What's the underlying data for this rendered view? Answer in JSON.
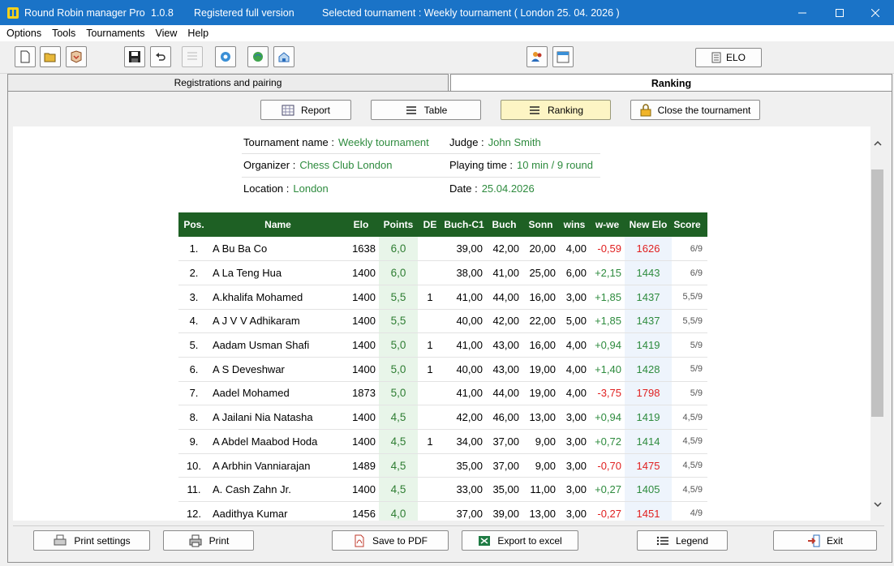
{
  "titlebar": {
    "app_name": "Round Robin manager Pro",
    "version": "1.0.8",
    "license": "Registered full version",
    "selected": "Selected tournament : Weekly tournament  ( London 25. 04. 2026 )"
  },
  "menu": [
    "Options",
    "Tools",
    "Tournaments",
    "View",
    "Help"
  ],
  "toolbar": {
    "elo_label": "ELO"
  },
  "tabs": {
    "registrations": "Registrations and pairing",
    "ranking": "Ranking"
  },
  "subbuttons": {
    "report": "Report",
    "table": "Table",
    "ranking": "Ranking",
    "close": "Close the tournament"
  },
  "info": {
    "name_label": "Tournament name :",
    "name_value": "Weekly tournament",
    "organizer_label": "Organizer :",
    "organizer_value": "Chess Club London",
    "location_label": "Location :",
    "location_value": "London",
    "judge_label": "Judge :",
    "judge_value": "John Smith",
    "playing_label": "Playing time :",
    "playing_value": "10 min / 9 round",
    "date_label": "Date :",
    "date_value": "25.04.2026"
  },
  "table": {
    "headers": [
      "Pos.",
      "Name",
      "Elo",
      "Points",
      "DE",
      "Buch-C1",
      "Buch",
      "Sonn",
      "wins",
      "w-we",
      "New Elo",
      "Score"
    ],
    "rows": [
      {
        "pos": "1.",
        "name": "A Bu Ba Co",
        "elo": "1638",
        "points": "6,0",
        "de": "",
        "buch1": "39,00",
        "buch": "42,00",
        "sonn": "20,00",
        "wins": "4,00",
        "wwe": "-0,59",
        "newelo": "1626",
        "score": "6/9"
      },
      {
        "pos": "2.",
        "name": "A La Teng Hua",
        "elo": "1400",
        "points": "6,0",
        "de": "",
        "buch1": "38,00",
        "buch": "41,00",
        "sonn": "25,00",
        "wins": "6,00",
        "wwe": "+2,15",
        "newelo": "1443",
        "score": "6/9"
      },
      {
        "pos": "3.",
        "name": "A.khalifa Mohamed",
        "elo": "1400",
        "points": "5,5",
        "de": "1",
        "buch1": "41,00",
        "buch": "44,00",
        "sonn": "16,00",
        "wins": "3,00",
        "wwe": "+1,85",
        "newelo": "1437",
        "score": "5,5/9"
      },
      {
        "pos": "4.",
        "name": "A J V V Adhikaram",
        "elo": "1400",
        "points": "5,5",
        "de": "",
        "buch1": "40,00",
        "buch": "42,00",
        "sonn": "22,00",
        "wins": "5,00",
        "wwe": "+1,85",
        "newelo": "1437",
        "score": "5,5/9"
      },
      {
        "pos": "5.",
        "name": "Aadam Usman Shafi",
        "elo": "1400",
        "points": "5,0",
        "de": "1",
        "buch1": "41,00",
        "buch": "43,00",
        "sonn": "16,00",
        "wins": "4,00",
        "wwe": "+0,94",
        "newelo": "1419",
        "score": "5/9"
      },
      {
        "pos": "6.",
        "name": "A S Deveshwar",
        "elo": "1400",
        "points": "5,0",
        "de": "1",
        "buch1": "40,00",
        "buch": "43,00",
        "sonn": "19,00",
        "wins": "4,00",
        "wwe": "+1,40",
        "newelo": "1428",
        "score": "5/9"
      },
      {
        "pos": "7.",
        "name": "Aadel Mohamed",
        "elo": "1873",
        "points": "5,0",
        "de": "",
        "buch1": "41,00",
        "buch": "44,00",
        "sonn": "19,00",
        "wins": "4,00",
        "wwe": "-3,75",
        "newelo": "1798",
        "score": "5/9"
      },
      {
        "pos": "8.",
        "name": "A Jailani Nia Natasha",
        "elo": "1400",
        "points": "4,5",
        "de": "",
        "buch1": "42,00",
        "buch": "46,00",
        "sonn": "13,00",
        "wins": "3,00",
        "wwe": "+0,94",
        "newelo": "1419",
        "score": "4,5/9"
      },
      {
        "pos": "9.",
        "name": "A Abdel Maabod Hoda",
        "elo": "1400",
        "points": "4,5",
        "de": "1",
        "buch1": "34,00",
        "buch": "37,00",
        "sonn": "9,00",
        "wins": "3,00",
        "wwe": "+0,72",
        "newelo": "1414",
        "score": "4,5/9"
      },
      {
        "pos": "10.",
        "name": "A Arbhin Vanniarajan",
        "elo": "1489",
        "points": "4,5",
        "de": "",
        "buch1": "35,00",
        "buch": "37,00",
        "sonn": "9,00",
        "wins": "3,00",
        "wwe": "-0,70",
        "newelo": "1475",
        "score": "4,5/9"
      },
      {
        "pos": "11.",
        "name": "A. Cash Zahn Jr.",
        "elo": "1400",
        "points": "4,5",
        "de": "",
        "buch1": "33,00",
        "buch": "35,00",
        "sonn": "11,00",
        "wins": "3,00",
        "wwe": "+0,27",
        "newelo": "1405",
        "score": "4,5/9"
      },
      {
        "pos": "12.",
        "name": "Aadithya Kumar",
        "elo": "1456",
        "points": "4,0",
        "de": "",
        "buch1": "37,00",
        "buch": "39,00",
        "sonn": "13,00",
        "wins": "3,00",
        "wwe": "-0,27",
        "newelo": "1451",
        "score": "4/9"
      }
    ]
  },
  "bottom": {
    "print_settings": "Print settings",
    "print": "Print",
    "save_pdf": "Save to PDF",
    "export_excel": "Export to excel",
    "legend": "Legend",
    "exit": "Exit"
  },
  "colors": {
    "titlebar": "#1a73c7",
    "header_green": "#1e6024",
    "value_green": "#2e8b3e",
    "negative_red": "#e02020",
    "active_button": "#fdf5c4"
  }
}
